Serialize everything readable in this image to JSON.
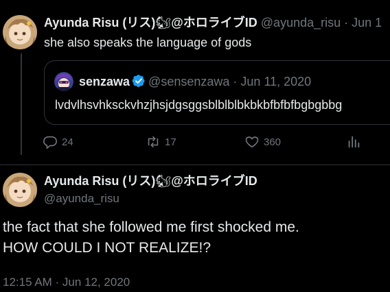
{
  "reply_tweet": {
    "author_name": "Ayunda Risu (リス)",
    "squirrel_emoji": "🐿",
    "name_suffix": "@ホロライブID",
    "handle": "@ayunda_risu",
    "dot": "·",
    "date": "Jun 1",
    "text": "she also speaks the language of gods",
    "quote": {
      "author_name": "senzawa",
      "handle": "@sensenzawa",
      "dot": "·",
      "date": "Jun 11, 2020",
      "text": "lvdvlhsvhksckvhzjhsjdgsggsblblblbkbkbfbfbfbgbgbbg"
    },
    "actions": {
      "replies": "24",
      "retweets": "17",
      "likes": "360"
    }
  },
  "main_tweet": {
    "author_name": "Ayunda Risu (リス)",
    "squirrel_emoji": "🐿",
    "name_suffix": "@ホロライブID",
    "handle": "@ayunda_risu",
    "text_line1": "the fact that she followed me first shocked me.",
    "text_line2": "HOW COULD I NOT REALIZE!?",
    "timestamp": "12:15 AM · Jun 12, 2020"
  },
  "colors": {
    "background": "#000000",
    "text_primary": "#e7e9ea",
    "text_secondary": "#71767b",
    "border": "#2f3336",
    "verified_blue": "#1d9bf0"
  }
}
